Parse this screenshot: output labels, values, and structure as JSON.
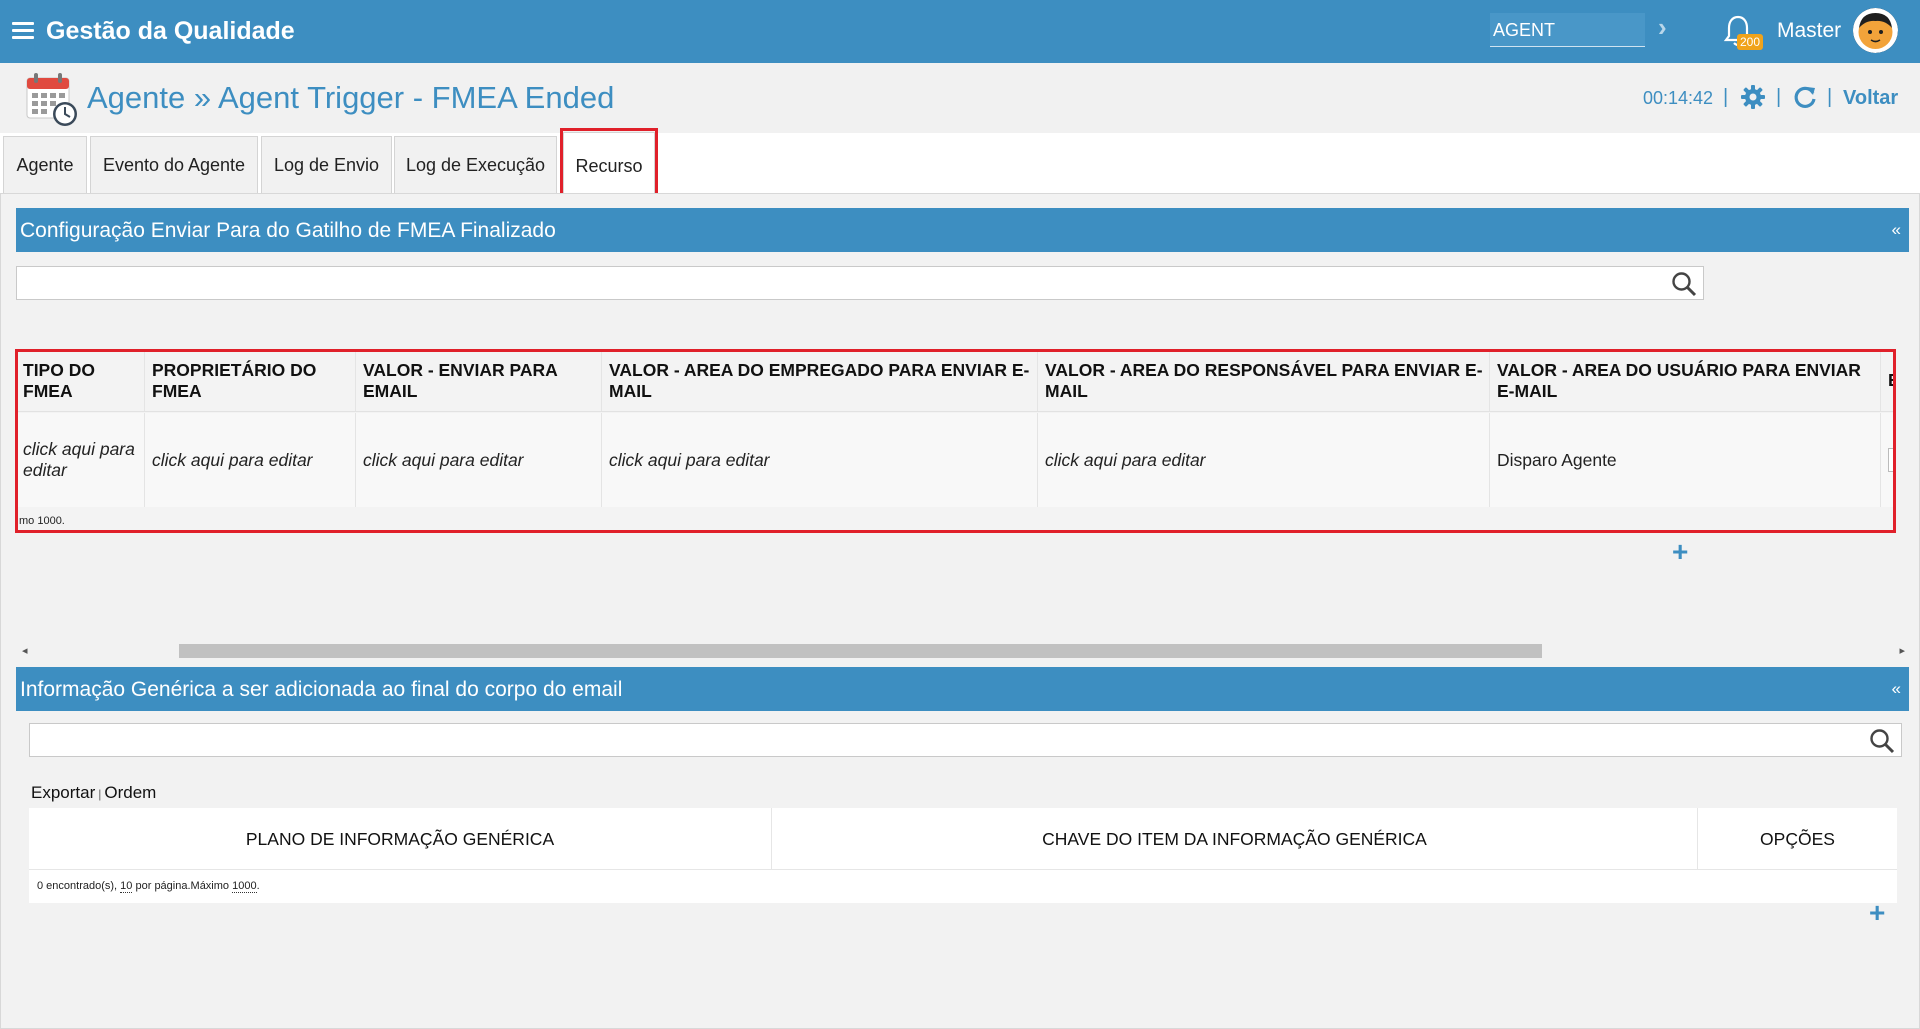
{
  "header": {
    "app_title": "Gestão da Qualidade",
    "agent_select": "AGENT",
    "notification_count": "200",
    "user_name": "Master"
  },
  "subheader": {
    "title": "Agente » Agent Trigger - FMEA Ended",
    "timer": "00:14:42",
    "separator": "|",
    "back_label": "Voltar"
  },
  "tabs": [
    {
      "label": "Agente"
    },
    {
      "label": "Evento do Agente"
    },
    {
      "label": "Log de Envio"
    },
    {
      "label": "Log de Execução"
    },
    {
      "label": "Recurso"
    }
  ],
  "panel1": {
    "title": "Configuração Enviar Para do Gatilho de FMEA Finalizado",
    "collapse": "«",
    "columns": [
      "TIPO DO FMEA",
      "PROPRIETÁRIO DO FMEA",
      "VALOR - ENVIAR PARA EMAIL",
      "VALOR - AREA DO EMPREGADO PARA ENVIAR E-MAIL",
      "VALOR - AREA DO RESPONSÁVEL PARA ENVIAR E-MAIL",
      "VALOR - AREA DO USUÁRIO PARA ENVIAR E-MAIL",
      "E"
    ],
    "row": [
      "click aqui para editar",
      "click aqui para editar",
      "click aqui para editar",
      "click aqui para editar",
      "click aqui para editar",
      "Disparo Agente"
    ],
    "footer": "mo 1000.",
    "add": "+"
  },
  "panel2": {
    "title": "Informação Genérica a ser adicionada ao final do corpo do email",
    "collapse": "«",
    "export_label": "Exportar",
    "link_separator": "|",
    "order_label": "Ordem",
    "columns": [
      "PLANO DE INFORMAÇÃO GENÉRICA",
      "CHAVE DO ITEM DA INFORMAÇÃO GENÉRICA",
      "OPÇÕES"
    ],
    "footer": {
      "found": "0 encontrado(s),",
      "per_page_value": "10",
      "per_page_text": "por página.Máximo",
      "max_value": "1000",
      "end": "."
    },
    "add": "+"
  },
  "colors": {
    "primary": "#3d8ec1",
    "highlight": "#e0202a",
    "badge": "#f0a31b"
  },
  "icons": [
    "menu-icon",
    "chevron-right-icon",
    "bell-icon",
    "avatar",
    "calendar-clock-icon",
    "gear-icon",
    "refresh-icon",
    "search-icon",
    "plus-icon"
  ]
}
